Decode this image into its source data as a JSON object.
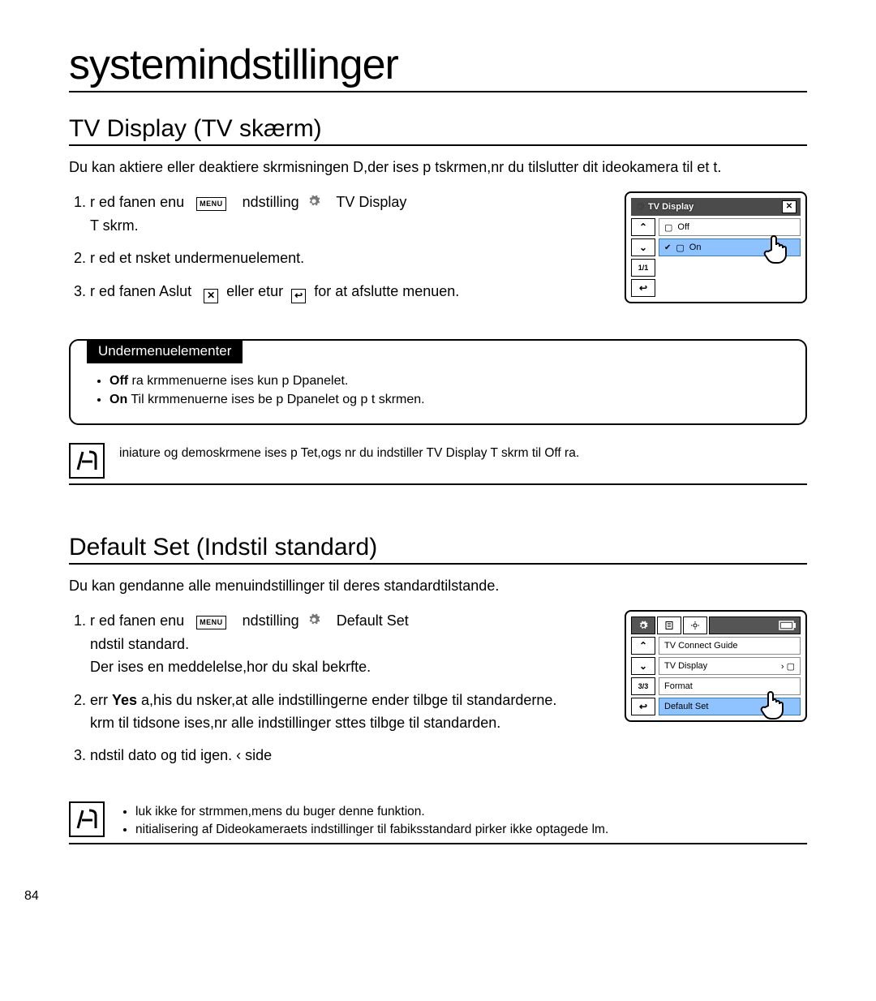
{
  "page": {
    "title": "systemindstillinger",
    "number": "84"
  },
  "section1": {
    "title": "TV Display (TV skærm)",
    "intro": "Du kan aktiere eller deaktiere skrmisningen D,der ises p tskrmen,nr du tilslutter dit ideokamera til et t.",
    "step1a": "r ed fanen enu",
    "step1b": "ndstilling",
    "step1c": "TV Display",
    "step1d": "T skrm.",
    "step2": "r ed et nsket undermenuelement.",
    "step3a": "r ed fanen Aslut",
    "step3b": "eller etur",
    "step3c": "for at afslutte menuen.",
    "submenu_header": "Undermenuelementer",
    "sub_off_b": "Off",
    "sub_off": " ra krmmenuerne ises kun p Dpanelet.",
    "sub_on_b": "On",
    "sub_on": " Til krmmenuerne ises be p Dpanelet og p t skrmen.",
    "note": "iniature og demoskrmene ises p Tet,ogs nr du indstiller TV Display T skrm til Off ra.",
    "ui": {
      "title": "TV Display",
      "page": "1/1",
      "off": "Off",
      "on": "On"
    }
  },
  "section2": {
    "title": "Default Set (Indstil standard)",
    "intro": "Du kan gendanne alle menuindstillinger til deres standardtilstande.",
    "step1a": "r ed fanen enu",
    "step1b": "ndstilling",
    "step1c": "Default Set",
    "step1d": "ndstil standard.",
    "step1e": "Der ises en meddelelse,hor du skal bekrfte.",
    "step2a": "err ",
    "step2yes": "Yes",
    "step2b": " a,his du nsker,at alle indstillingerne ender tilbge til standarderne.",
    "step2c": "krm til tidsone ises,nr alle indstillinger sttes tilbge til standarden.",
    "step3": "ndstil dato og tid igen.   ‹ side",
    "note1": "luk ikke for strmmen,mens du buger denne funktion.",
    "note2": "nitialisering af Dideokameraets indstillinger til fabiksstandard pirker ikke optagede lm.",
    "ui": {
      "page": "3/3",
      "i1": "TV Connect Guide",
      "i2": "TV Display",
      "i3": "Format",
      "i4": "Default Set"
    }
  }
}
